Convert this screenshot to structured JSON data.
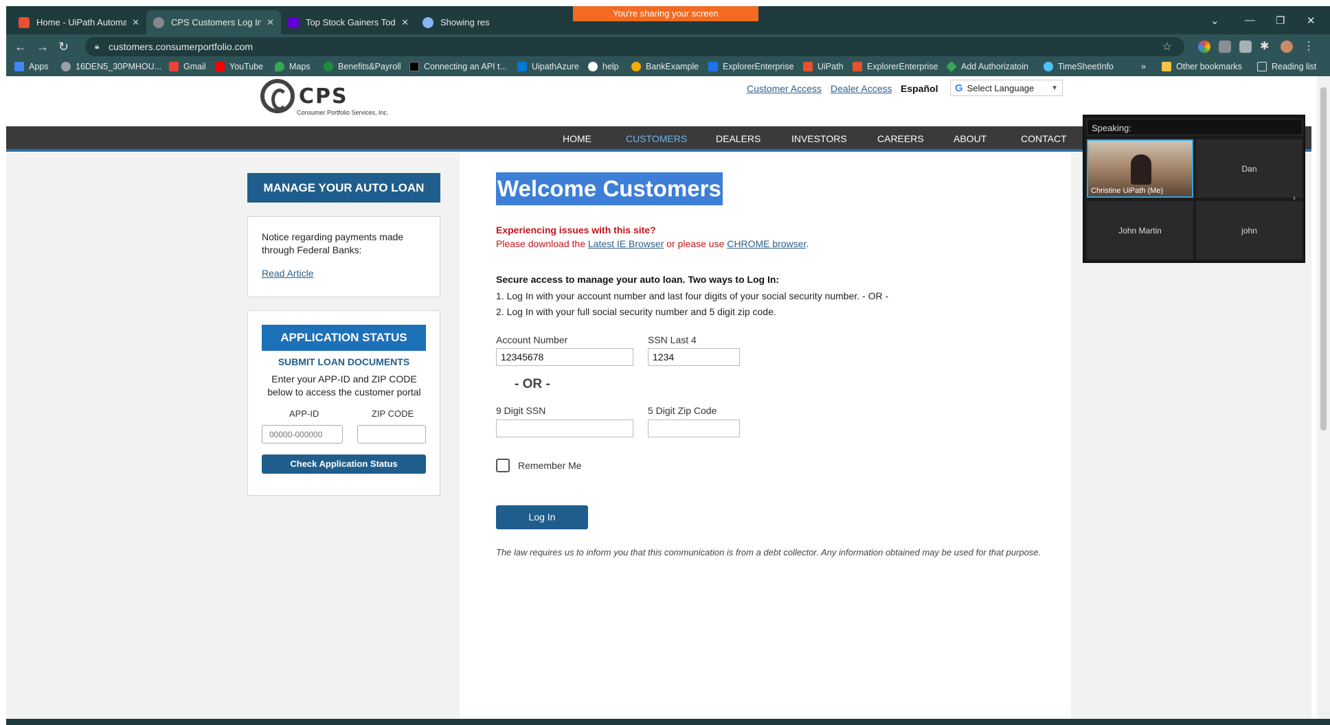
{
  "browser": {
    "tabs": [
      {
        "title": "Home - UiPath Automation Clou",
        "favicon_color": "#e8502e",
        "active": false
      },
      {
        "title": "CPS Customers Log In",
        "favicon_color": "#888888",
        "active": true
      },
      {
        "title": "Top Stock Gainers Today - Yahoo",
        "favicon_color": "#6001d2",
        "active": false
      },
      {
        "title": "Showing res",
        "favicon_color": "#8ab4f8",
        "active": false
      }
    ],
    "sharing_banner": "You're sharing your screen",
    "url": "customers.consumerportfolio.com",
    "bookmarks": [
      {
        "label": "Apps",
        "icon_color": "#4285f4"
      },
      {
        "label": "16DEN5_30PMHOU...",
        "icon_color": "#9aa0a6"
      },
      {
        "label": "Gmail",
        "icon_color": "#ea4335"
      },
      {
        "label": "YouTube",
        "icon_color": "#ff0000"
      },
      {
        "label": "Maps",
        "icon_color": "#34a853"
      },
      {
        "label": "Benefits&Payroll",
        "icon_color": "#1e8e3e"
      },
      {
        "label": "Connecting an API t...",
        "icon_color": "#000000"
      },
      {
        "label": "UipathAzure",
        "icon_color": "#0078d4"
      },
      {
        "label": "help",
        "icon_color": "#ffffff"
      },
      {
        "label": "BankExample",
        "icon_color": "#f9ab00"
      },
      {
        "label": "ExplorerEnterprise",
        "icon_color": "#1a73e8"
      },
      {
        "label": "UiPath",
        "icon_color": "#e8502e"
      },
      {
        "label": "ExplorerEnterprise",
        "icon_color": "#e8502e"
      },
      {
        "label": "Add Authorizatoin",
        "icon_color": "#34a853"
      },
      {
        "label": "TimeSheetInfo",
        "icon_color": "#4fc3f7"
      }
    ],
    "more_bookmarks": "»",
    "other_bookmarks": "Other bookmarks",
    "reading_list": "Reading list"
  },
  "site": {
    "logo_text": "CPS",
    "logo_sub": "Consumer Portfolio Services, Inc.",
    "top_links": {
      "customer_access": "Customer Access",
      "dealer_access": "Dealer Access",
      "espanol": "Español"
    },
    "language_select": "Select Language",
    "nav": [
      "HOME",
      "CUSTOMERS",
      "DEALERS",
      "INVESTORS",
      "CAREERS",
      "ABOUT",
      "CONTACT"
    ],
    "nav_active": "CUSTOMERS"
  },
  "sidebar": {
    "manage_button": "MANAGE YOUR AUTO LOAN",
    "notice_text": "Notice regarding payments made through Federal Banks:",
    "notice_link": "Read Article",
    "app_status": {
      "header": "APPLICATION STATUS",
      "submit_docs": "SUBMIT LOAN DOCUMENTS",
      "description": "Enter your APP-ID and ZIP CODE below to access the customer portal",
      "app_id_label": "APP-ID",
      "zip_label": "ZIP CODE",
      "app_id_placeholder": "00000-000000",
      "zip_value": "",
      "check_button": "Check Application Status"
    }
  },
  "main": {
    "welcome_title": "Welcome Customers",
    "issues_title": "Experiencing issues with this site?",
    "issues_prefix": "Please download the ",
    "issues_link_ie": "Latest IE Browser",
    "issues_middle": " or please use ",
    "issues_link_chrome": "CHROME browser",
    "issues_suffix": ".",
    "secure_title": "Secure access to manage your auto loan. Two ways to Log In:",
    "secure_option_1": "1. Log In with your account number and last four digits of your social security number. - OR -",
    "secure_option_2": "2. Log In with your full social security number and 5 digit zip code.",
    "account_label": "Account Number",
    "account_value": "12345678",
    "ssn_last4_label": "SSN Last 4",
    "ssn_last4_value": "1234",
    "or_text": "- OR -",
    "ssn9_label": "9 Digit SSN",
    "ssn9_value": "",
    "zip5_label": "5 Digit Zip Code",
    "zip5_value": "",
    "remember_label": "Remember Me",
    "login_button": "Log In",
    "law_text": "The law requires us to inform you that this communication is from a debt collector. Any information obtained may be used for that purpose."
  },
  "meeting": {
    "speaking_label": "Speaking:",
    "participants": [
      {
        "name": "Christine UiPath (Me)"
      },
      {
        "name": "Dan"
      },
      {
        "name": "John Martin"
      },
      {
        "name": "john"
      }
    ]
  },
  "colors": {
    "chrome_dark": "#1f3b3d",
    "chrome_mid": "#2f5457",
    "brand_blue": "#1f5e8c",
    "nav_active": "#6cb6ec",
    "error_red": "#c0151b",
    "share_orange": "#f26b21"
  }
}
